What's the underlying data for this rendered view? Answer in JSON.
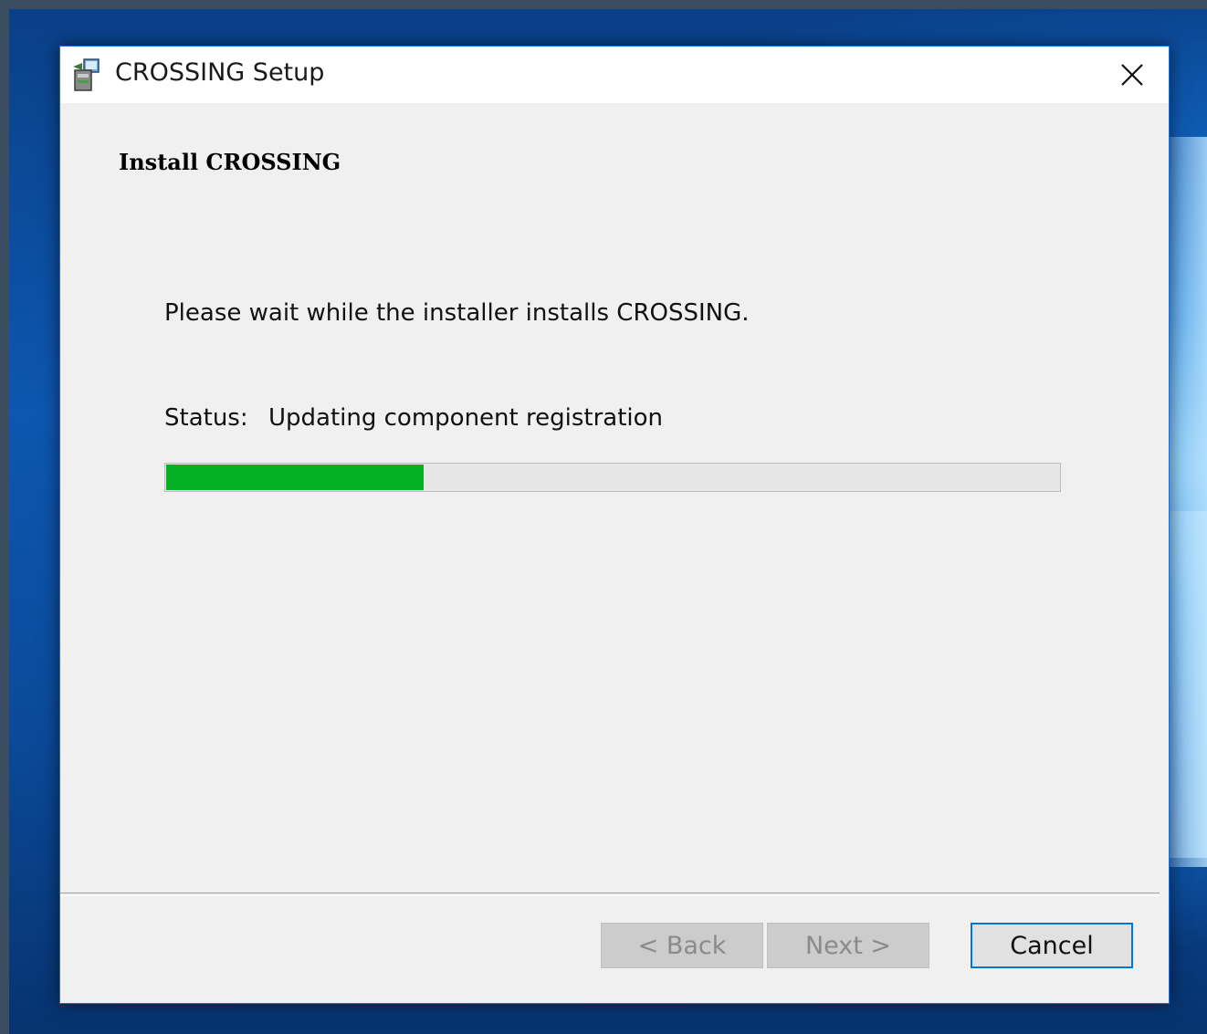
{
  "window": {
    "title": "CROSSING Setup",
    "app_icon": "installer-icon",
    "close_icon": "close-icon"
  },
  "page": {
    "heading": "Install CROSSING",
    "message": "Please wait while the installer installs CROSSING.",
    "status_label": "Status:",
    "status_value": "Updating component registration"
  },
  "progress": {
    "percent": 29,
    "color": "#06b025"
  },
  "buttons": {
    "back": "< Back",
    "next": "Next >",
    "cancel": "Cancel"
  },
  "colors": {
    "accent": "#0078d7",
    "dialog_bg": "#f0f0f0"
  }
}
